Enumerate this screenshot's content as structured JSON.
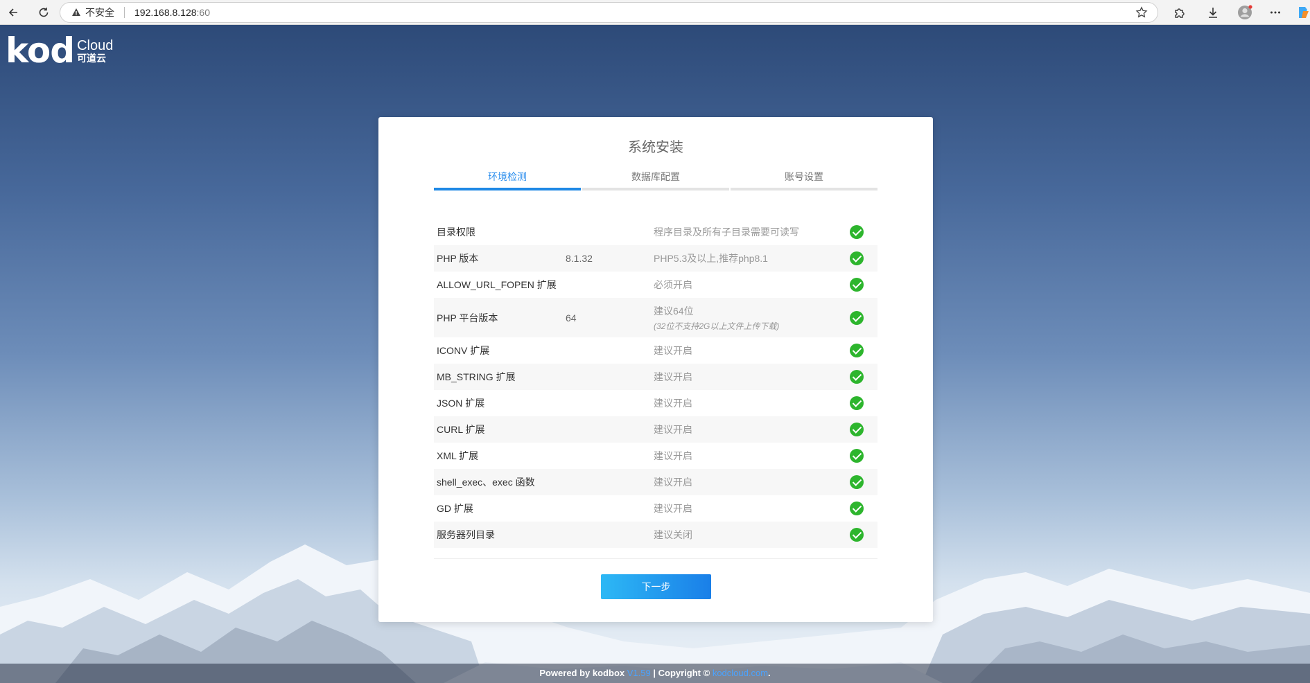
{
  "browser": {
    "security_label": "不安全",
    "host": "192.168.8.128",
    "port": ":60"
  },
  "logo": {
    "kod": "kod",
    "cloud": "Cloud",
    "cn": "可道云"
  },
  "panel": {
    "title": "系统安装",
    "steps": [
      {
        "label": "环境检测",
        "active": true
      },
      {
        "label": "数据库配置",
        "active": false
      },
      {
        "label": "账号设置",
        "active": false
      }
    ],
    "checks": [
      {
        "name": "目录权限",
        "value": "",
        "requirement": "程序目录及所有子目录需要可读写",
        "note": ""
      },
      {
        "name": "PHP 版本",
        "value": "8.1.32",
        "requirement": "PHP5.3及以上,推荐php8.1",
        "note": ""
      },
      {
        "name": "ALLOW_URL_FOPEN 扩展",
        "value": "",
        "requirement": "必须开启",
        "note": ""
      },
      {
        "name": "PHP 平台版本",
        "value": "64",
        "requirement": "建议64位",
        "note": "(32位不支持2G以上文件上传下载)"
      },
      {
        "name": "ICONV 扩展",
        "value": "",
        "requirement": "建议开启",
        "note": ""
      },
      {
        "name": "MB_STRING 扩展",
        "value": "",
        "requirement": "建议开启",
        "note": ""
      },
      {
        "name": "JSON 扩展",
        "value": "",
        "requirement": "建议开启",
        "note": ""
      },
      {
        "name": "CURL 扩展",
        "value": "",
        "requirement": "建议开启",
        "note": ""
      },
      {
        "name": "XML 扩展",
        "value": "",
        "requirement": "建议开启",
        "note": ""
      },
      {
        "name": "shell_exec、exec 函数",
        "value": "",
        "requirement": "建议开启",
        "note": ""
      },
      {
        "name": "GD 扩展",
        "value": "",
        "requirement": "建议开启",
        "note": ""
      },
      {
        "name": "服务器列目录",
        "value": "",
        "requirement": "建议关闭",
        "note": ""
      }
    ],
    "next_label": "下一步"
  },
  "footer": {
    "powered": "Powered by kodbox",
    "version": "V1.59",
    "sep": "|",
    "copyright": "Copyright ©",
    "site": "kodcloud.com",
    "dot": "."
  },
  "colors": {
    "accent": "#1e88e5",
    "ok": "#2db52d"
  },
  "icons": {
    "back": "arrow-left-icon",
    "reload": "reload-icon",
    "warning": "warning-icon",
    "star": "star-icon",
    "extension": "extension-icon",
    "download": "download-icon",
    "profile": "profile-icon",
    "menu": "more-icon",
    "check": "check-circle-icon"
  }
}
